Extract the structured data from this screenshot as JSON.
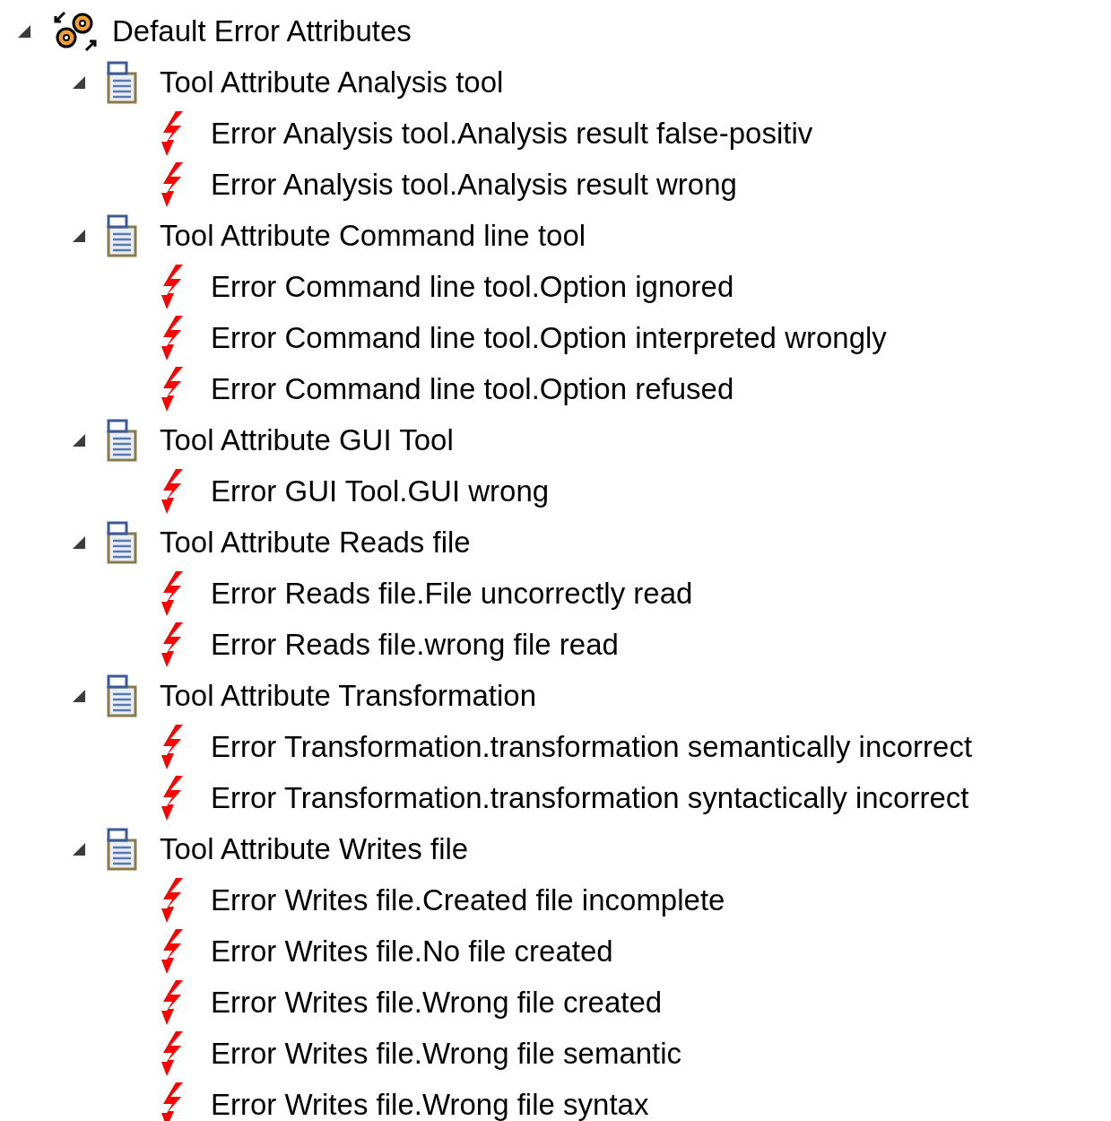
{
  "tree": [
    {
      "label": "Default Error Attributes",
      "kind": "root",
      "expanded": true,
      "children": [
        {
          "label": "Tool Attribute Analysis tool",
          "kind": "attribute",
          "expanded": true,
          "children": [
            {
              "label": "Error Analysis tool.Analysis result false-positiv",
              "kind": "error"
            },
            {
              "label": "Error Analysis tool.Analysis result wrong",
              "kind": "error"
            }
          ]
        },
        {
          "label": "Tool Attribute Command line tool",
          "kind": "attribute",
          "expanded": true,
          "children": [
            {
              "label": "Error Command line tool.Option ignored",
              "kind": "error"
            },
            {
              "label": "Error Command line tool.Option interpreted wrongly",
              "kind": "error"
            },
            {
              "label": "Error Command line tool.Option refused",
              "kind": "error"
            }
          ]
        },
        {
          "label": "Tool Attribute GUI Tool",
          "kind": "attribute",
          "expanded": true,
          "children": [
            {
              "label": "Error GUI Tool.GUI wrong",
              "kind": "error"
            }
          ]
        },
        {
          "label": "Tool Attribute Reads file",
          "kind": "attribute",
          "expanded": true,
          "children": [
            {
              "label": "Error Reads file.File uncorrectly read",
              "kind": "error"
            },
            {
              "label": "Error Reads file.wrong file read",
              "kind": "error"
            }
          ]
        },
        {
          "label": "Tool Attribute Transformation",
          "kind": "attribute",
          "expanded": true,
          "children": [
            {
              "label": "Error Transformation.transformation semantically incorrect",
              "kind": "error"
            },
            {
              "label": "Error Transformation.transformation syntactically incorrect",
              "kind": "error"
            }
          ]
        },
        {
          "label": "Tool Attribute Writes file",
          "kind": "attribute",
          "expanded": true,
          "children": [
            {
              "label": "Error Writes file.Created file incomplete",
              "kind": "error"
            },
            {
              "label": "Error Writes file.No file created",
              "kind": "error"
            },
            {
              "label": "Error Writes file.Wrong file created",
              "kind": "error"
            },
            {
              "label": "Error Writes file.Wrong file semantic",
              "kind": "error"
            },
            {
              "label": "Error Writes file.Wrong file syntax",
              "kind": "error"
            }
          ]
        }
      ]
    }
  ]
}
